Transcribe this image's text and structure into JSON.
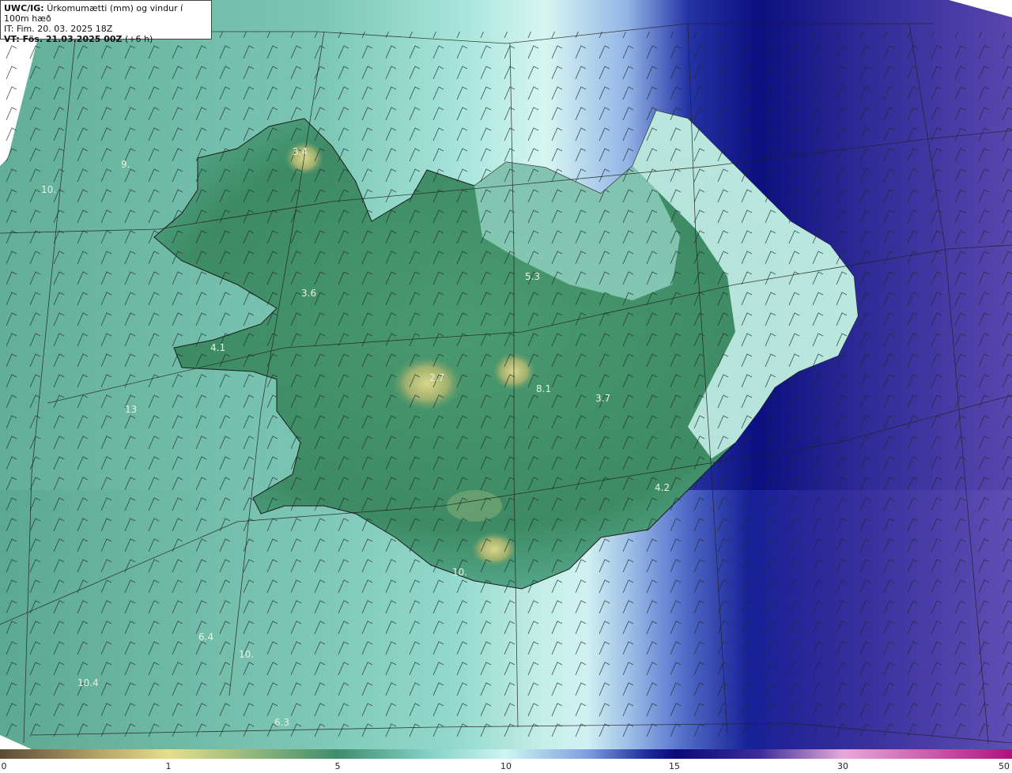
{
  "header": {
    "model": "UWC/IG:",
    "product": "Úrkomumætti (mm) og vindur í 100m hæð",
    "init_time": "IT: Fim. 20. 03. 2025 18Z",
    "valid_time": "VT: Fös. 21.03.2025 00Z",
    "lead": "(+6 h)"
  },
  "colorbar": {
    "ticks": [
      "0",
      "1",
      "5",
      "10",
      "15",
      "30",
      "50"
    ],
    "colors": [
      "#5c4a36",
      "#b8a56a",
      "#e6df8a",
      "#3f8d6d",
      "#7fcfc3",
      "#cdf5f1",
      "#7f9fdf",
      "#1d2a9c",
      "#0a0a7a",
      "#3b2c9a",
      "#e7a9d9",
      "#b0127e"
    ]
  },
  "map": {
    "colors": {
      "land_green": "#3e8d66",
      "sea_green": "#6fb9a4",
      "pale": "#c8f0ec",
      "deep_blue": "#0d137f",
      "purple": "#4a3aa6"
    },
    "value_labels": [
      "3.4",
      "3.6",
      "4.1",
      "5.3",
      "2.7",
      "8.1",
      "3.7",
      "4.2",
      "6.4",
      "10.",
      "10.4",
      "6.3",
      "9.",
      "10.",
      "13",
      "10."
    ]
  }
}
